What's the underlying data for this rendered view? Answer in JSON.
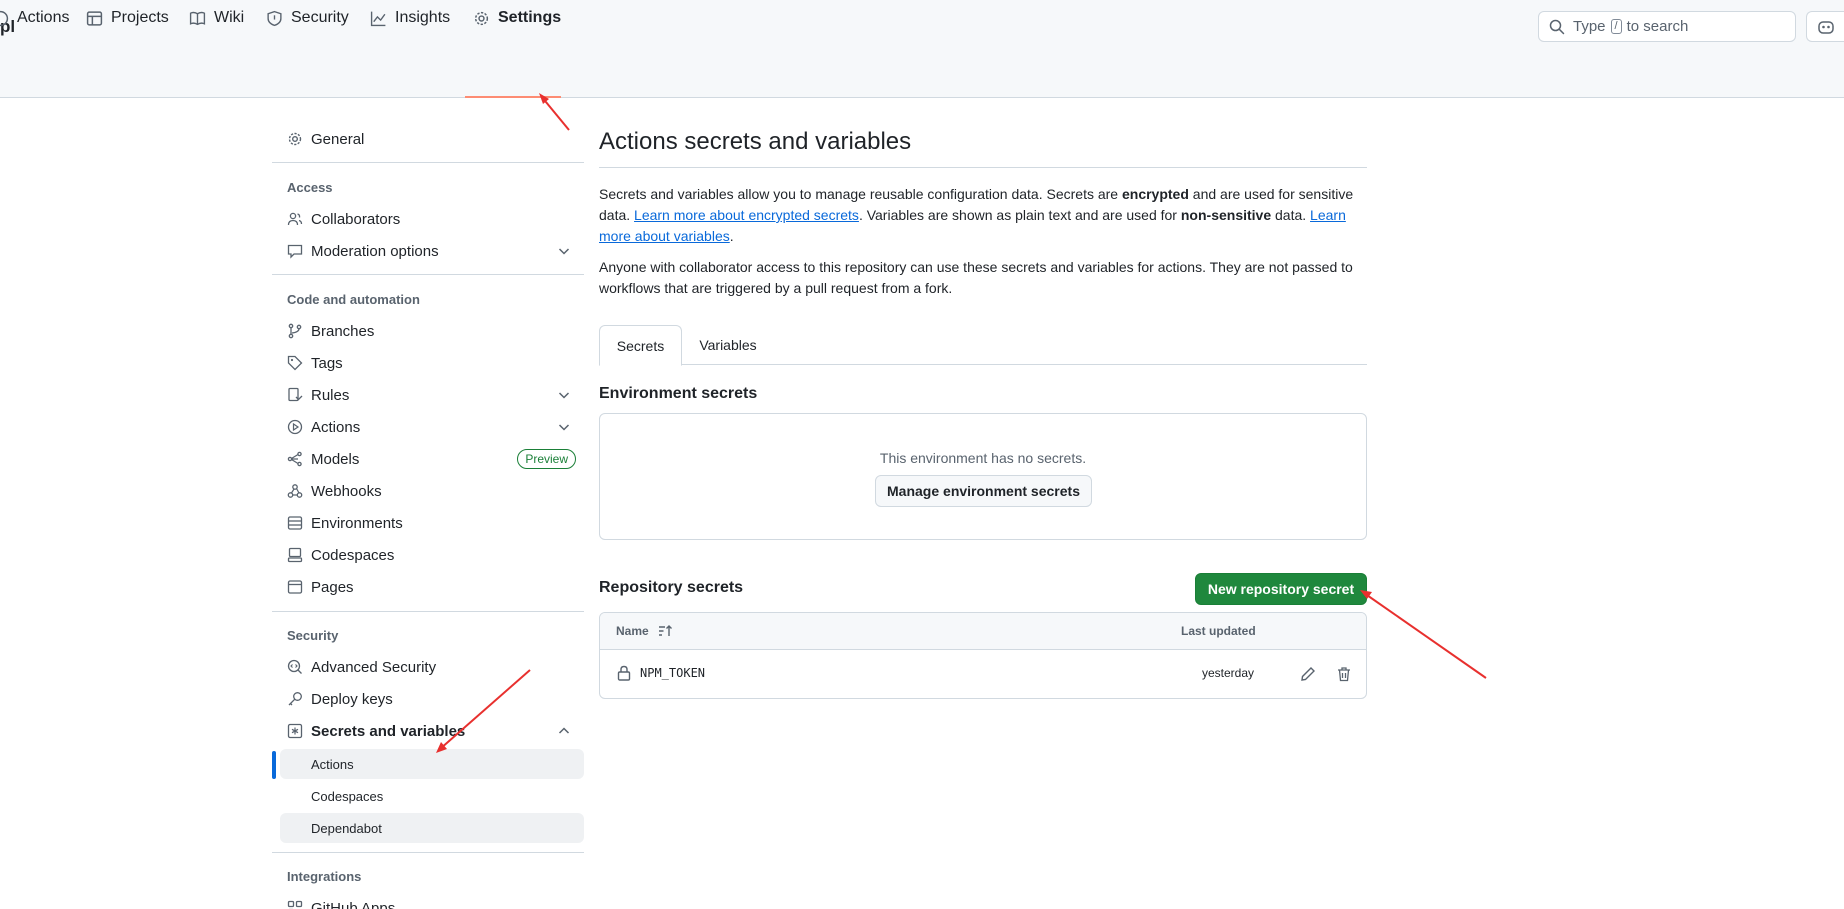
{
  "header": {
    "repo_fragment": "pl",
    "search": {
      "prefix": "Type",
      "key": "/",
      "suffix": "to search"
    }
  },
  "repo_tabs": [
    {
      "label": "Actions",
      "icon": "play-icon"
    },
    {
      "label": "Projects",
      "icon": "table-icon"
    },
    {
      "label": "Wiki",
      "icon": "book-icon"
    },
    {
      "label": "Security",
      "icon": "shield-icon"
    },
    {
      "label": "Insights",
      "icon": "graph-icon"
    },
    {
      "label": "Settings",
      "icon": "gear-icon",
      "active": true
    }
  ],
  "sidebar": {
    "general": "General",
    "access_heading": "Access",
    "collaborators": "Collaborators",
    "moderation": "Moderation options",
    "code_heading": "Code and automation",
    "branches": "Branches",
    "tags": "Tags",
    "rules": "Rules",
    "actions": "Actions",
    "models": "Models",
    "models_badge": "Preview",
    "webhooks": "Webhooks",
    "environments": "Environments",
    "codespaces": "Codespaces",
    "pages": "Pages",
    "security_heading": "Security",
    "advanced_security": "Advanced Security",
    "deploy_keys": "Deploy keys",
    "secrets_variables": "Secrets and variables",
    "sub_actions": "Actions",
    "sub_codespaces": "Codespaces",
    "sub_dependabot": "Dependabot",
    "integrations_heading": "Integrations",
    "github_apps": "GitHub Apps"
  },
  "main": {
    "title": "Actions secrets and variables",
    "intro": {
      "t1": "Secrets and variables allow you to manage reusable configuration data. Secrets are ",
      "b1": "encrypted",
      "t2": " and are used for sensitive data. ",
      "link1": "Learn more about encrypted secrets",
      "t3": ". Variables are shown as plain text and are used for ",
      "b2": "non-sensitive",
      "t4": " data. ",
      "link2": "Learn more about variables",
      "t5": "."
    },
    "note": "Anyone with collaborator access to this repository can use these secrets and variables for actions. They are not passed to workflows that are triggered by a pull request from a fork.",
    "tabs": {
      "secrets": "Secrets",
      "variables": "Variables"
    },
    "env_heading": "Environment secrets",
    "env_empty": "This environment has no secrets.",
    "manage_env_button": "Manage environment secrets",
    "repo_heading": "Repository secrets",
    "new_secret_button": "New repository secret",
    "table": {
      "col_name": "Name",
      "col_updated": "Last updated",
      "rows": [
        {
          "name": "NPM_TOKEN",
          "updated": "yesterday"
        }
      ]
    }
  },
  "colors": {
    "accent": "#0969da",
    "primary_button": "#1f883d",
    "annotation_arrow": "#e8302e",
    "tab_underline": "#fd8c73"
  }
}
